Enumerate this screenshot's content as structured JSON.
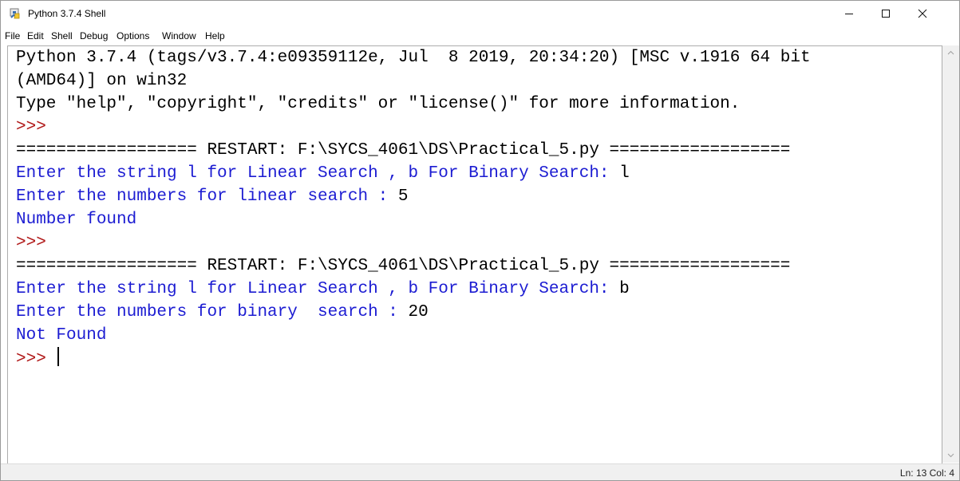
{
  "window": {
    "title": "Python 3.7.4 Shell",
    "app_icon": "python-idle-icon",
    "controls": [
      "minimize-icon",
      "maximize-icon",
      "close-icon"
    ]
  },
  "menu": [
    "File",
    "Edit",
    "Shell",
    "Debug",
    "Options",
    "Window",
    "Help"
  ],
  "shell": {
    "lines": [
      {
        "text": "Python 3.7.4 (tags/v3.7.4:e09359112e, Jul  8 2019, 20:34:20) [MSC v.1916 64 bit",
        "color": "black"
      },
      {
        "text": "(AMD64)] on win32",
        "color": "black"
      },
      {
        "text": "Type \"help\", \"copyright\", \"credits\" or \"license()\" for more information.",
        "color": "black"
      },
      {
        "text": ">>>",
        "color": "maroon"
      },
      {
        "text": "================== RESTART: F:\\SYCS_4061\\DS\\Practical_5.py ==================",
        "color": "black"
      },
      {
        "text": "Enter the string l for Linear Search , b For Binary Search: ",
        "input": "l",
        "color": "blue"
      },
      {
        "text": "Enter the numbers for linear search : ",
        "input": "5",
        "color": "blue"
      },
      {
        "text": "Number found",
        "color": "blue"
      },
      {
        "text": ">>>",
        "color": "maroon"
      },
      {
        "text": "================== RESTART: F:\\SYCS_4061\\DS\\Practical_5.py ==================",
        "color": "black"
      },
      {
        "text": "Enter the string l for Linear Search , b For Binary Search: ",
        "input": "b",
        "color": "blue"
      },
      {
        "text": "Enter the numbers for binary  search : ",
        "input": "20",
        "color": "blue"
      },
      {
        "text": "Not Found",
        "color": "blue"
      },
      {
        "text": ">>> ",
        "color": "maroon",
        "cursor": true
      }
    ]
  },
  "status": {
    "line_label": "Ln: 13",
    "col_label": "Col: 4"
  },
  "colors": {
    "output": "#1c1cd2",
    "prompt": "#b01717",
    "text": "#000000"
  }
}
